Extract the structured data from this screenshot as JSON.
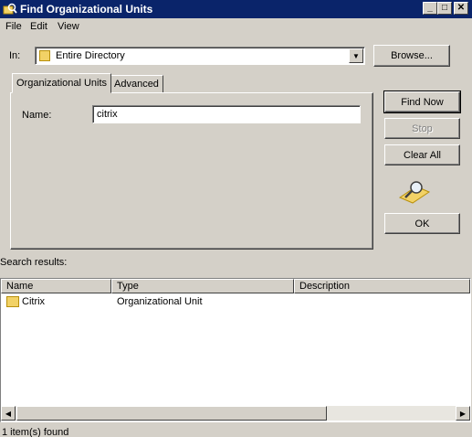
{
  "window": {
    "title": "Find Organizational Units",
    "min_icon": "minimize-icon",
    "max_icon": "maximize-icon",
    "close_icon": "close-icon"
  },
  "menu": {
    "items": [
      "File",
      "Edit",
      "View"
    ]
  },
  "search_in": {
    "label": "In:",
    "value": "Entire Directory",
    "browse_label": "Browse..."
  },
  "tabs": [
    {
      "label": "Organizational Units",
      "active": true
    },
    {
      "label": "Advanced",
      "active": false
    }
  ],
  "name_field": {
    "label": "Name:",
    "value": "citrix"
  },
  "buttons": {
    "find_now": "Find Now",
    "stop": "Stop",
    "clear_all": "Clear All",
    "ok": "OK"
  },
  "results": {
    "label": "Search results:",
    "columns": [
      "Name",
      "Type",
      "Description"
    ],
    "rows": [
      {
        "name": "Citrix",
        "type": "Organizational Unit",
        "description": ""
      }
    ]
  },
  "status": {
    "text": "1 item(s) found"
  },
  "colors": {
    "titlebar": "#0a246a",
    "face": "#d4d0c8",
    "folder": "#f2d266"
  }
}
